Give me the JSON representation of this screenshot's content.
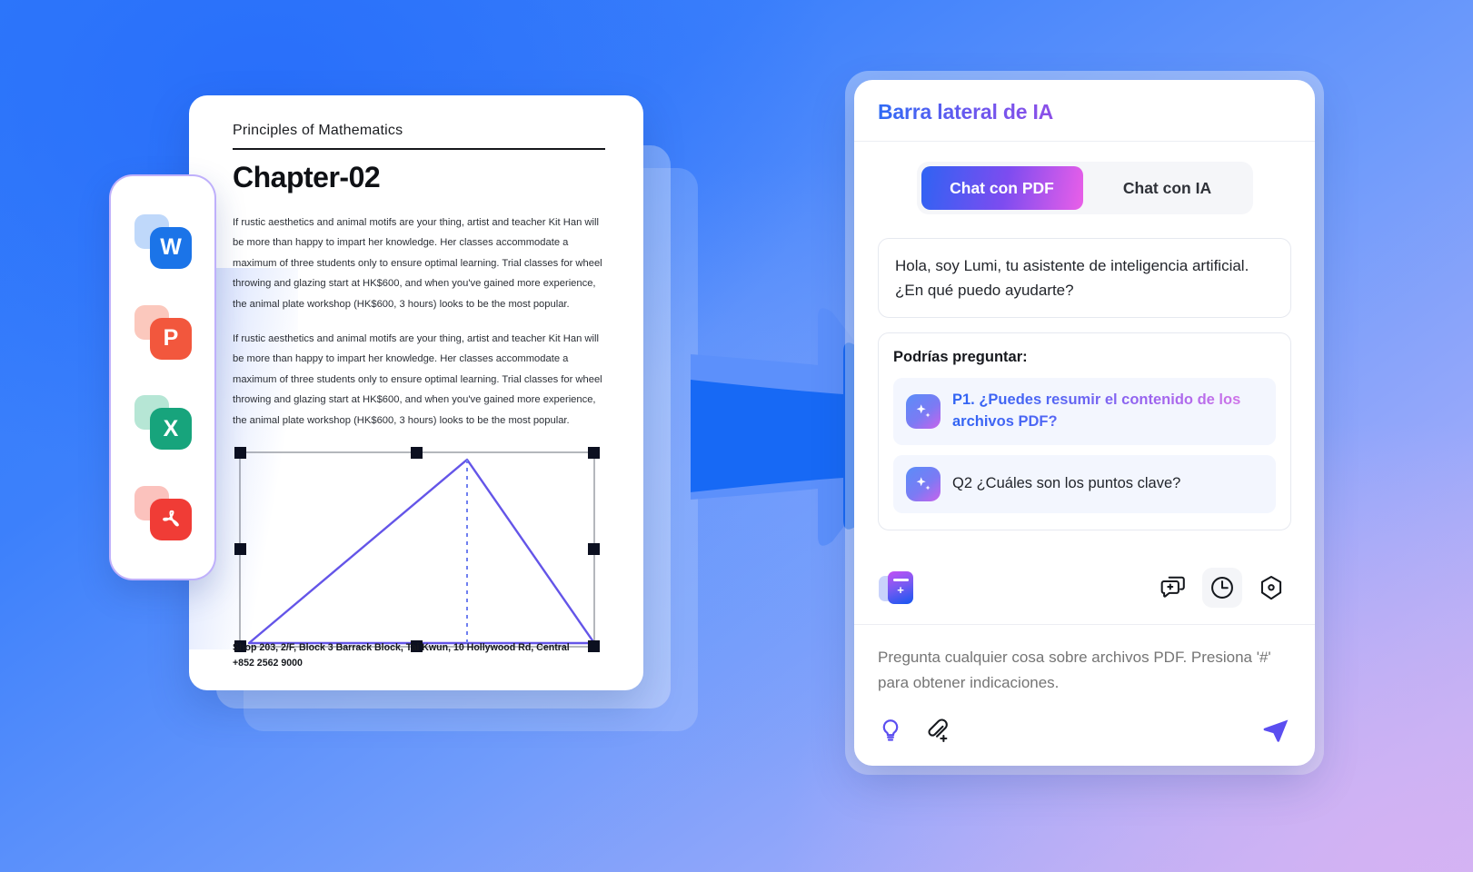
{
  "background": {
    "gradient_from": "#2f7bfb",
    "gradient_to": "#cdb6f2"
  },
  "file_rail": {
    "name": "file-types-rail",
    "items": [
      {
        "label": "W",
        "name": "word-file-icon",
        "color": "#1b74e8",
        "ghost": "#bfd8fa"
      },
      {
        "label": "P",
        "name": "powerpoint-file-icon",
        "color": "#f2573d",
        "ghost": "#fbc8bd"
      },
      {
        "label": "X",
        "name": "excel-file-icon",
        "color": "#17a47c",
        "ghost": "#b6e6d5"
      },
      {
        "label": "",
        "name": "pdf-file-icon",
        "color": "#f03c36",
        "ghost": "#fbc2bd"
      }
    ]
  },
  "document": {
    "header": "Principles of Mathematics",
    "chapter": "Chapter-02",
    "paragraphs": [
      "If rustic aesthetics and animal motifs are your thing, artist and teacher Kit Han will be more than happy to impart her knowledge. Her classes accommodate a maximum of three students only to ensure optimal learning. Trial classes for wheel throwing and glazing start at HK$600, and when you've gained more experience, the animal plate workshop (HK$600, 3 hours) looks to be the most popular.",
      "If rustic aesthetics and animal motifs are your thing, artist and teacher Kit Han will be more than happy to impart her knowledge. Her classes accommodate a maximum of three students only to ensure optimal learning. Trial classes for wheel throwing and glazing start at HK$600, and when you've gained more experience, the animal plate workshop (HK$600, 3 hours) looks to be the most popular.",
      "Shop 203, 2/F, Block 3 Barrack Block, Tai Kwun, 10 Hollywood Rd, Central",
      "+852 2562 9000"
    ],
    "footer_line_1": "Shop 203, 2/F, Block 3 Barrack Block, Tai Kwun, 10 Hollywood Rd, Central",
    "footer_line_2": "+852 2562 9000",
    "figure": {
      "name": "triangle-shape",
      "stroke": "#6455e8",
      "selected": true,
      "handle_color": "#0c1020"
    }
  },
  "sidebar": {
    "title": "Barra lateral de IA",
    "title_gradient_from": "#2f6bf5",
    "title_gradient_to": "#8c4fe8",
    "tabs": [
      {
        "label": "Chat con PDF",
        "name": "tab-chat-con-pdf",
        "active": true
      },
      {
        "label": "Chat con IA",
        "name": "tab-chat-con-ia",
        "active": false
      }
    ],
    "greeting": "Hola, soy Lumi, tu asistente de inteligencia artificial. ¿En qué puedo ayudarte?",
    "suggestions": {
      "heading": "Podrías preguntar:",
      "items": [
        {
          "text": "P1. ¿Puedes resumir el contenido de los archivos PDF?",
          "gradient": true,
          "icon": "sparkle-icon"
        },
        {
          "text": "Q2 ¿Cuáles son los puntos clave?",
          "gradient": false,
          "icon": "sparkle-icon"
        }
      ]
    },
    "toolbar": {
      "library": "add-to-library-icon",
      "new_chat": "new-chat-icon",
      "history": "history-clock-icon",
      "settings": "settings-hexagon-icon",
      "selected": "history-clock-icon"
    },
    "composer": {
      "placeholder": "Pregunta cualquier cosa sobre archivos PDF. Presiona '#' para obtener indicaciones.",
      "value": "",
      "actions": {
        "prompt": "lightbulb-icon",
        "attach": "attachment-add-icon",
        "send": "send-icon"
      },
      "accent": "#5b4ef0"
    }
  }
}
